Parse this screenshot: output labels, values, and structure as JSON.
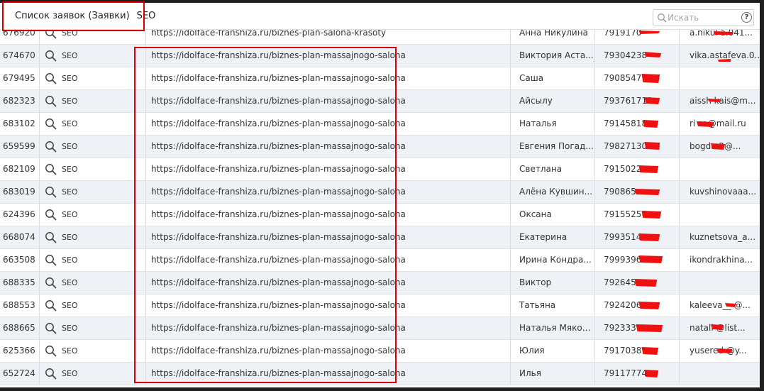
{
  "header": {
    "breadcrumb_parent": "Список заявок (Заявки)",
    "breadcrumb_current": "SEO",
    "search_placeholder": "Искать",
    "help_label": "?"
  },
  "rows": [
    {
      "id": "676920",
      "source": "SEO",
      "url": "https://idolface-franshiza.ru/biznes-plan-salona-krasoty",
      "name": "Анна Никулина",
      "phone": "7919170",
      "email": "a.nikul      a.041..."
    },
    {
      "id": "674670",
      "source": "SEO",
      "url": "https://idolface-franshiza.ru/biznes-plan-massajnogo-salona",
      "name": "Виктория Аста...",
      "phone": "79304238",
      "email": "vika.astafeva.0..."
    },
    {
      "id": "679495",
      "source": "SEO",
      "url": "https://idolface-franshiza.ru/biznes-plan-massajnogo-salona",
      "name": "Саша",
      "phone": "79085479",
      "email": ""
    },
    {
      "id": "682323",
      "source": "SEO",
      "url": "https://idolface-franshiza.ru/biznes-plan-massajnogo-salona",
      "name": "Айсылу",
      "phone": "793761713",
      "email": "aissh      kais@m..."
    },
    {
      "id": "683102",
      "source": "SEO",
      "url": "https://idolface-franshiza.ru/biznes-plan-massajnogo-salona",
      "name": "Наталья",
      "phone": "79145818",
      "email": "ri      sa@mail.ru"
    },
    {
      "id": "659599",
      "source": "SEO",
      "url": "https://idolface-franshiza.ru/biznes-plan-massajnogo-salona",
      "name": "Евгения Погад...",
      "phone": "79827130",
      "email": "bogda      2@..."
    },
    {
      "id": "682109",
      "source": "SEO",
      "url": "https://idolface-franshiza.ru/biznes-plan-massajnogo-salona",
      "name": "Светлана",
      "phone": "7915022",
      "email": ""
    },
    {
      "id": "683019",
      "source": "SEO",
      "url": "https://idolface-franshiza.ru/biznes-plan-massajnogo-salona",
      "name": "Алёна Кувшин...",
      "phone": "790865",
      "email": "kuvshinovaaa..."
    },
    {
      "id": "624396",
      "source": "SEO",
      "url": "https://idolface-franshiza.ru/biznes-plan-massajnogo-salona",
      "name": "Оксана",
      "phone": "79155256",
      "email": ""
    },
    {
      "id": "668074",
      "source": "SEO",
      "url": "https://idolface-franshiza.ru/biznes-plan-massajnogo-salona",
      "name": "Екатерина",
      "phone": "7993514",
      "email": "kuznetsova_a..."
    },
    {
      "id": "663508",
      "source": "SEO",
      "url": "https://idolface-franshiza.ru/biznes-plan-massajnogo-salona",
      "name": "Ирина Кондра...",
      "phone": "7999396",
      "email": "ikondrakhina..."
    },
    {
      "id": "688335",
      "source": "SEO",
      "url": "https://idolface-franshiza.ru/biznes-plan-massajnogo-salona",
      "name": "Виктор",
      "phone": "792645",
      "email": ""
    },
    {
      "id": "688553",
      "source": "SEO",
      "url": "https://idolface-franshiza.ru/biznes-plan-massajnogo-salona",
      "name": "Татьяна",
      "phone": "7924206",
      "email": "kaleeva__      @..."
    },
    {
      "id": "688665",
      "source": "SEO",
      "url": "https://idolface-franshiza.ru/biznes-plan-massajnogo-salona",
      "name": "Наталья Мякот...",
      "phone": "792333",
      "email": "natali      @list..."
    },
    {
      "id": "625366",
      "source": "SEO",
      "url": "https://idolface-franshiza.ru/biznes-plan-massajnogo-salona",
      "name": "Юлия",
      "phone": "7917038",
      "email": "yusered      @y..."
    },
    {
      "id": "652724",
      "source": "SEO",
      "url": "https://idolface-franshiza.ru/biznes-plan-massajnogo-salona",
      "name": "Илья",
      "phone": "79117774",
      "email": ""
    }
  ],
  "colors": {
    "highlight_box": "#d60000",
    "redaction": "#ee1111",
    "row_alt": "#eef2f6",
    "border": "#dcdcdc",
    "text": "#333333"
  },
  "icons": {
    "row_source": "magnifier-icon",
    "search": "search-icon",
    "help": "help-icon"
  }
}
